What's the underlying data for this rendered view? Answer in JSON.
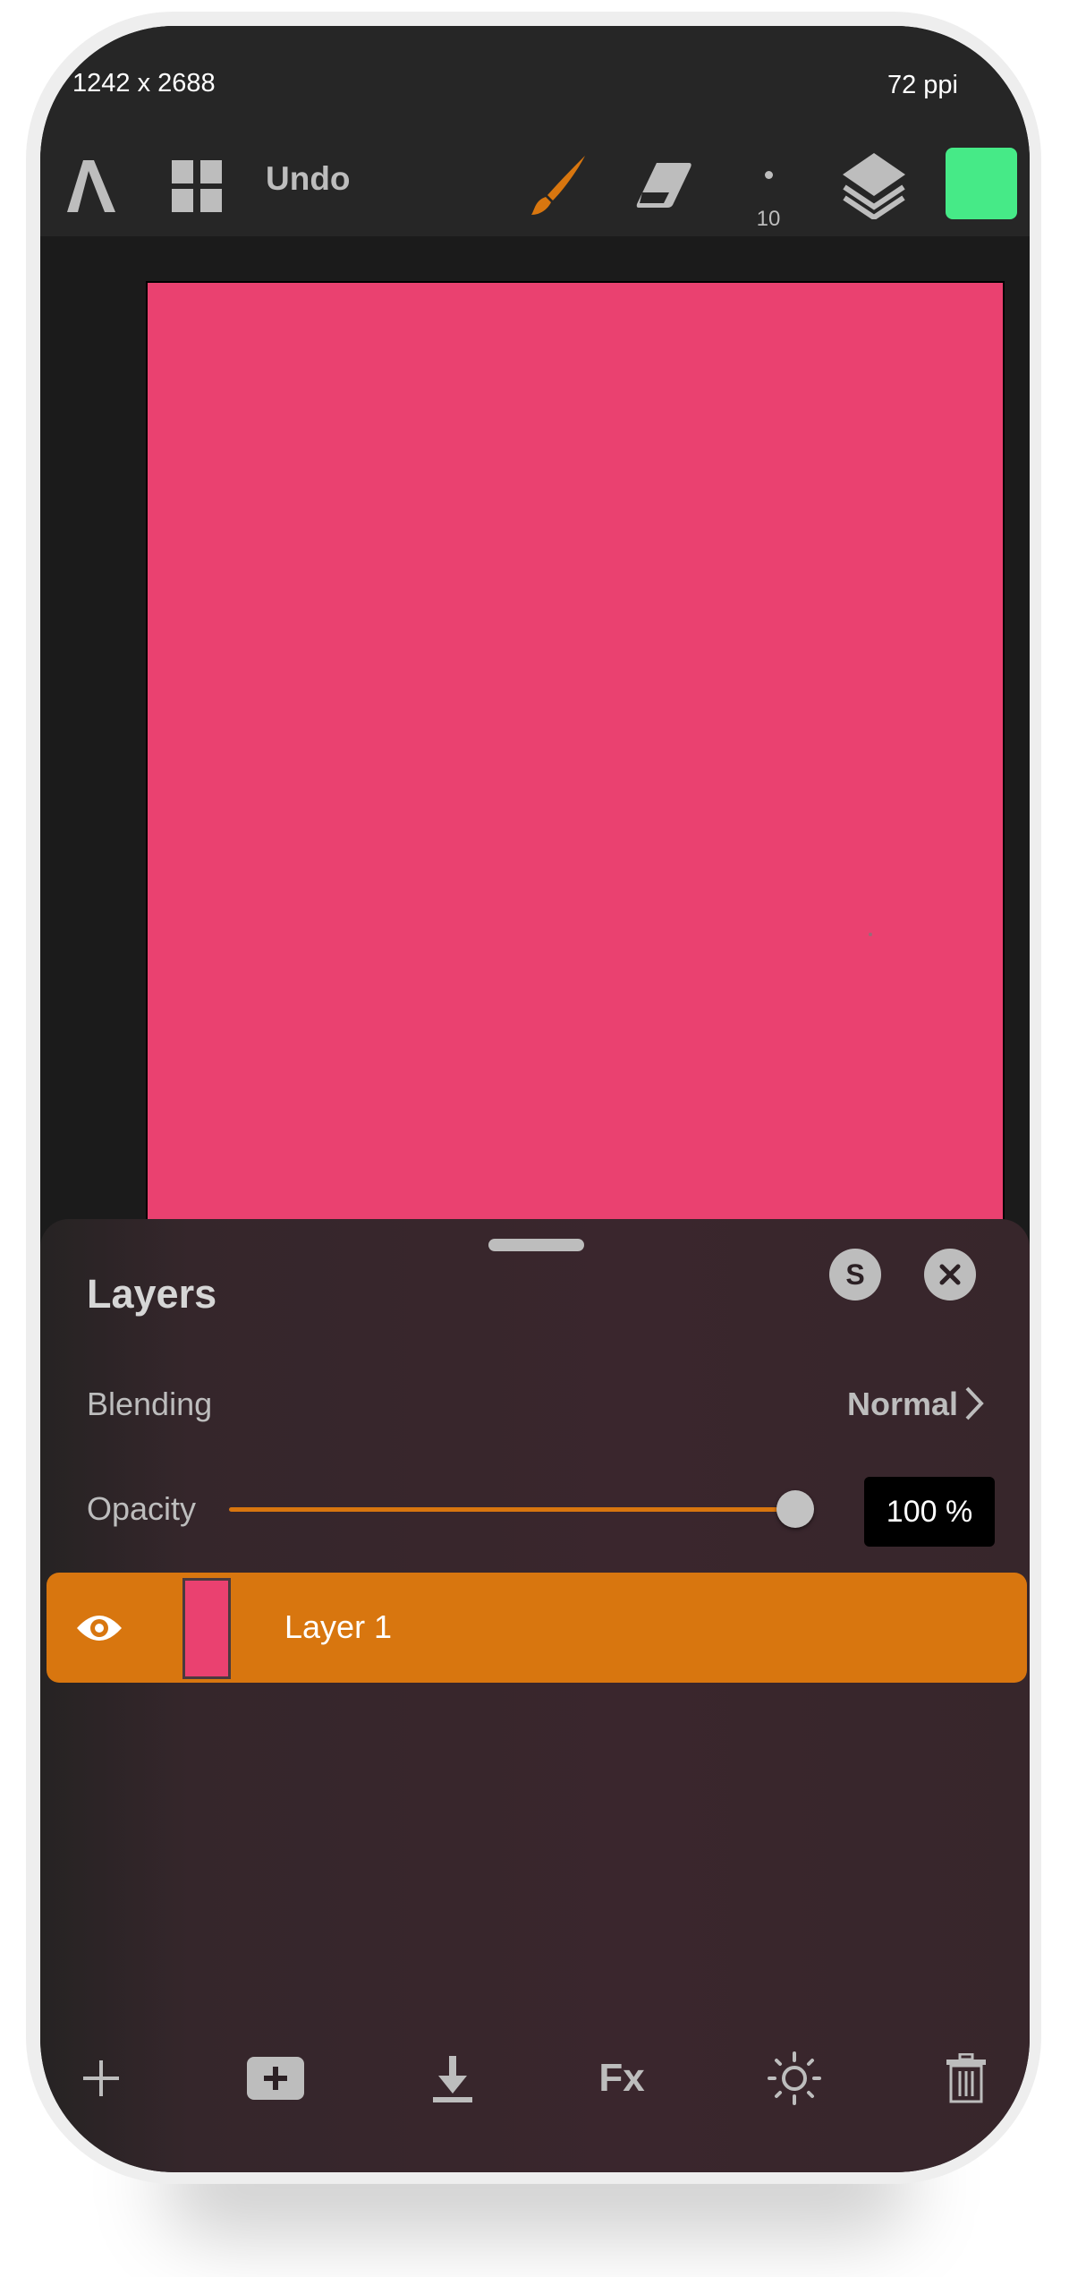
{
  "status": {
    "dimensions": "1242 x 2688",
    "resolution": "72 ppi"
  },
  "toolbar": {
    "logo_icon": "a-logo-icon",
    "grid_icon": "gallery-grid-icon",
    "undo_label": "Undo",
    "brush_icon": "brush-icon",
    "eraser_icon": "eraser-icon",
    "brush_size": "10",
    "layers_icon": "layers-icon",
    "current_color": "#46ea87",
    "accent": "#d8760f"
  },
  "canvas": {
    "fill_color": "#ea4170"
  },
  "layers_panel": {
    "title": "Layers",
    "s_button": "S",
    "blending_label": "Blending",
    "blending_value": "Normal",
    "opacity_label": "Opacity",
    "opacity_value": "100 %",
    "opacity_percent": 100,
    "layers": [
      {
        "name": "Layer 1",
        "visible": true,
        "selected": true
      }
    ],
    "bottom_actions": [
      "add-icon",
      "add-group-icon",
      "merge-down-icon",
      "fx",
      "adjust-icon",
      "trash-icon"
    ],
    "fx_label": "Fx"
  }
}
